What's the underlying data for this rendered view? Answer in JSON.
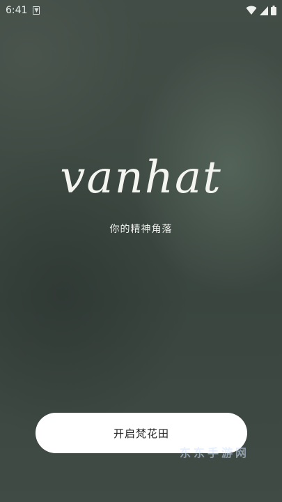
{
  "status_bar": {
    "time": "6:41",
    "notification_icon": "download-notification-icon",
    "wifi_icon": "wifi-icon",
    "signal_icon": "cell-signal-icon",
    "battery_icon": "battery-icon"
  },
  "splash": {
    "brand_name": "vanhat",
    "tagline": "你的精神角落",
    "start_button_label": "开启梵花田"
  },
  "watermark": {
    "text": "东东手游网"
  },
  "colors": {
    "background": "#3e4a43",
    "button_background": "#ffffff",
    "button_text": "#222222",
    "text_light": "#f4f5f1"
  }
}
